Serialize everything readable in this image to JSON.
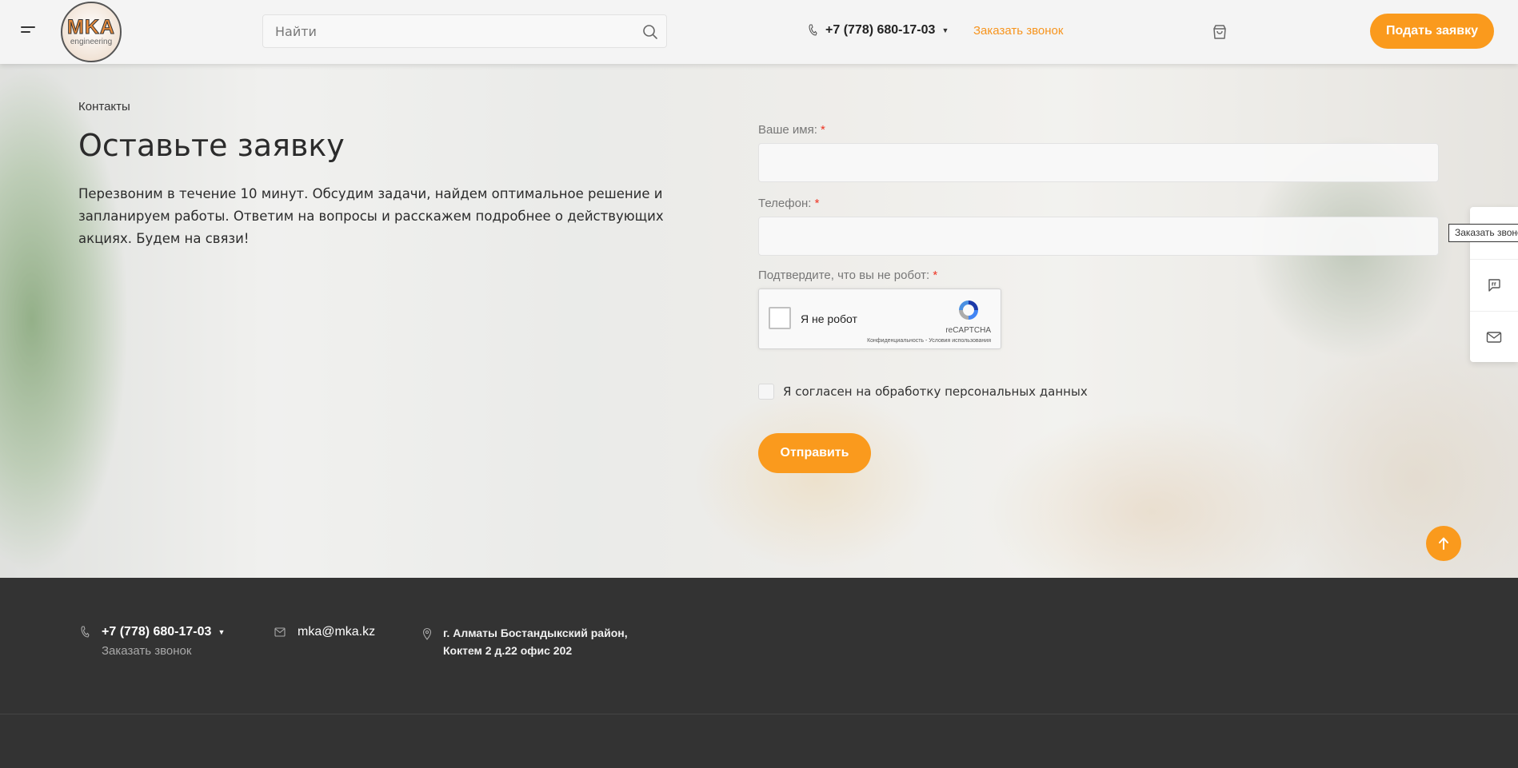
{
  "header": {
    "logo_text": "MKA",
    "logo_sub": "engineering",
    "search_placeholder": "Найти",
    "phone": "+7 (778) 680-17-03",
    "callback_label": "Заказать звонок",
    "request_button": "Подать заявку"
  },
  "hero": {
    "breadcrumb": "Контакты",
    "title": "Оставьте заявку",
    "intro_line1": "Перезвоним в течение 10 минут. Обсудим задачи, найдем оптимальное решение и",
    "intro_line2": "запланируем работы. Ответим на вопросы и расскажем подробнее о действующих",
    "intro_line3": "акциях. Будем на связи!"
  },
  "form": {
    "name_label": "Ваше имя:",
    "name_value": "",
    "phone_label": "Телефон:",
    "phone_value": "",
    "captcha_label": "Подтвердите, что вы не робот:",
    "required_mark": "*",
    "recaptcha": {
      "checkbox_label": "Я не робот",
      "brand": "reCAPTCHA",
      "terms": "Конфиденциальность - Условия использования"
    },
    "consent_label": "Я согласен на обработку персональных данных",
    "submit_button": "Отправить"
  },
  "side_widget": {
    "tooltip": "Заказать звонок",
    "icons": [
      "phone-icon",
      "chat-icon",
      "mail-icon"
    ]
  },
  "footer": {
    "phone": "+7 (778) 680-17-03",
    "callback_label": "Заказать звонок",
    "email": "mka@mka.kz",
    "address_line1": "г. Алматы Бостандыкский район,",
    "address_line2": "Коктем 2 д.22 офис 202"
  },
  "colors": {
    "accent": "#fa9a1d",
    "link_accent": "#f7941d",
    "footer_bg": "#333333",
    "header_bg": "#f4f4f4",
    "required": "#ee3322"
  }
}
